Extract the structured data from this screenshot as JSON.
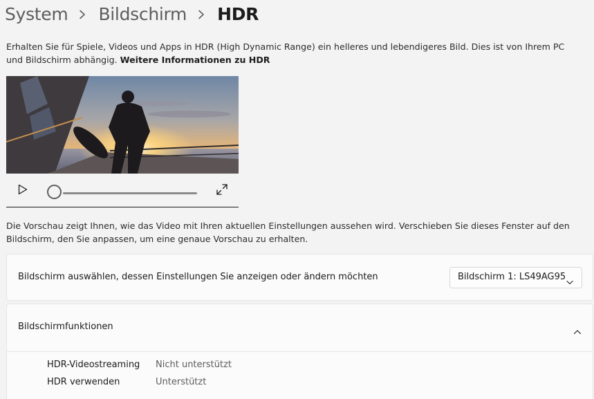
{
  "breadcrumb": {
    "items": [
      "System",
      "Bildschirm"
    ],
    "current": "HDR"
  },
  "description": {
    "text": "Erhalten Sie für Spiele, Videos und Apps in HDR (High Dynamic Range) ein helleres und lebendigeres Bild. Dies ist von Ihrem PC und Bildschirm abhängig. ",
    "link": "Weitere Informationen zu HDR"
  },
  "video": {
    "play_icon": "play-icon",
    "fullscreen_icon": "fullscreen-icon",
    "progress": 0
  },
  "preview_note": "Die Vorschau zeigt Ihnen, wie das Video mit Ihren aktuellen Einstellungen aussehen wird. Verschieben Sie dieses Fenster auf den Bildschirm, den Sie anpassen, um eine genaue Vorschau zu erhalten.",
  "display_select": {
    "label": "Bildschirm auswählen, dessen Einstellungen Sie anzeigen oder ändern möchten",
    "selected": "Bildschirm 1: LS49AG95"
  },
  "features": {
    "title": "Bildschirmfunktionen",
    "rows": [
      {
        "name": "HDR-Videostreaming",
        "value": "Nicht unterstützt"
      },
      {
        "name": "HDR verwenden",
        "value": "Unterstützt"
      }
    ]
  }
}
